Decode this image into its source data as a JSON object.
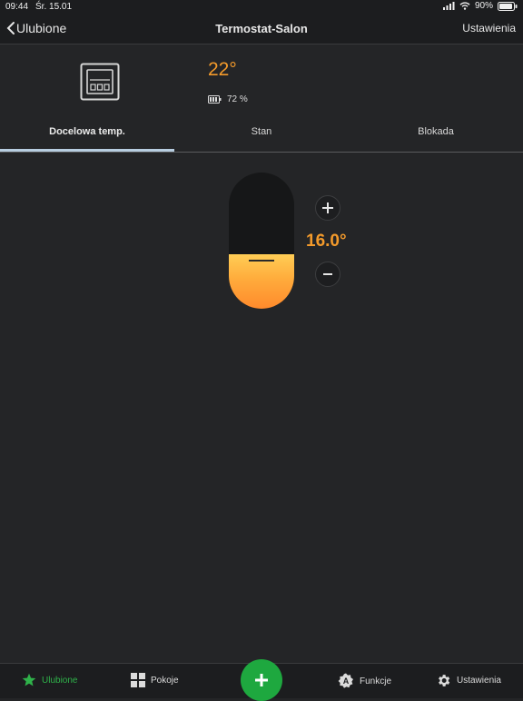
{
  "status_bar": {
    "time": "09:44",
    "date": "Śr. 15.01",
    "battery": "90%"
  },
  "nav": {
    "back_label": "Ulubione",
    "title": "Termostat-Salon",
    "settings_label": "Ustawienia"
  },
  "device": {
    "current_temp": "22°",
    "battery_percent": "72 %"
  },
  "tabs": [
    {
      "label": "Docelowa temp.",
      "active": true
    },
    {
      "label": "Stan",
      "active": false
    },
    {
      "label": "Blokada",
      "active": false
    }
  ],
  "thermostat": {
    "setpoint": "16.0°",
    "level_fraction": 0.4
  },
  "bottom_nav": {
    "favorites": "Ulubione",
    "rooms": "Pokoje",
    "functions": "Funkcje",
    "settings": "Ustawienia"
  },
  "colors": {
    "accent": "#f39a2b",
    "active_green": "#2fb24a",
    "fab": "#1ea83f",
    "background": "#242527"
  },
  "icons": {
    "status": [
      "signal-icon",
      "wifi-icon",
      "battery-icon"
    ],
    "nav": [
      "chevron-left-icon"
    ],
    "device": [
      "thermostat-device-icon",
      "battery-small-icon"
    ],
    "controls": [
      "plus-icon",
      "minus-icon"
    ],
    "bottom": [
      "star-icon",
      "grid-icon",
      "plus-icon",
      "functions-a-icon",
      "gear-icon"
    ]
  }
}
